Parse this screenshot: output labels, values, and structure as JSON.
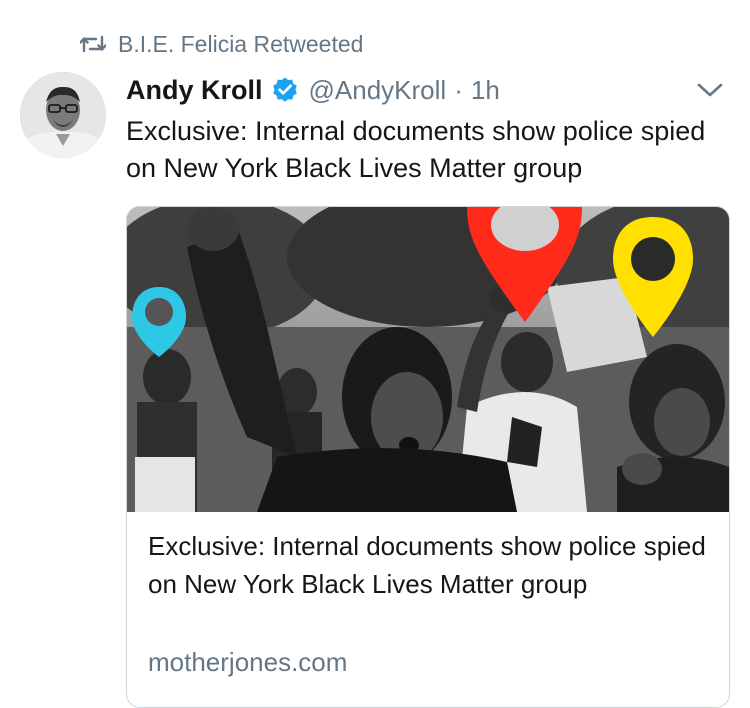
{
  "retweet": {
    "icon": "retweet-icon",
    "text": "B.I.E. Felicia Retweeted"
  },
  "tweet": {
    "author_name": "Andy Kroll",
    "verified_icon": "verified-badge-icon",
    "handle": "@AndyKroll",
    "separator": "·",
    "time": "1h",
    "menu_icon": "chevron-down-icon",
    "text": "Exclusive: Internal documents show police spied on New York Black Lives Matter group"
  },
  "card": {
    "image_description": "protest-photo",
    "title": "Exclusive: Internal documents show police spied on New York Black Lives Matter group",
    "domain": "motherjones.com"
  },
  "colors": {
    "text": "#14171a",
    "secondary": "#657786",
    "verified": "#1da1f2",
    "pin_cyan": "#2ec8e6",
    "pin_red": "#ff2a1a",
    "pin_yellow": "#ffe000"
  }
}
